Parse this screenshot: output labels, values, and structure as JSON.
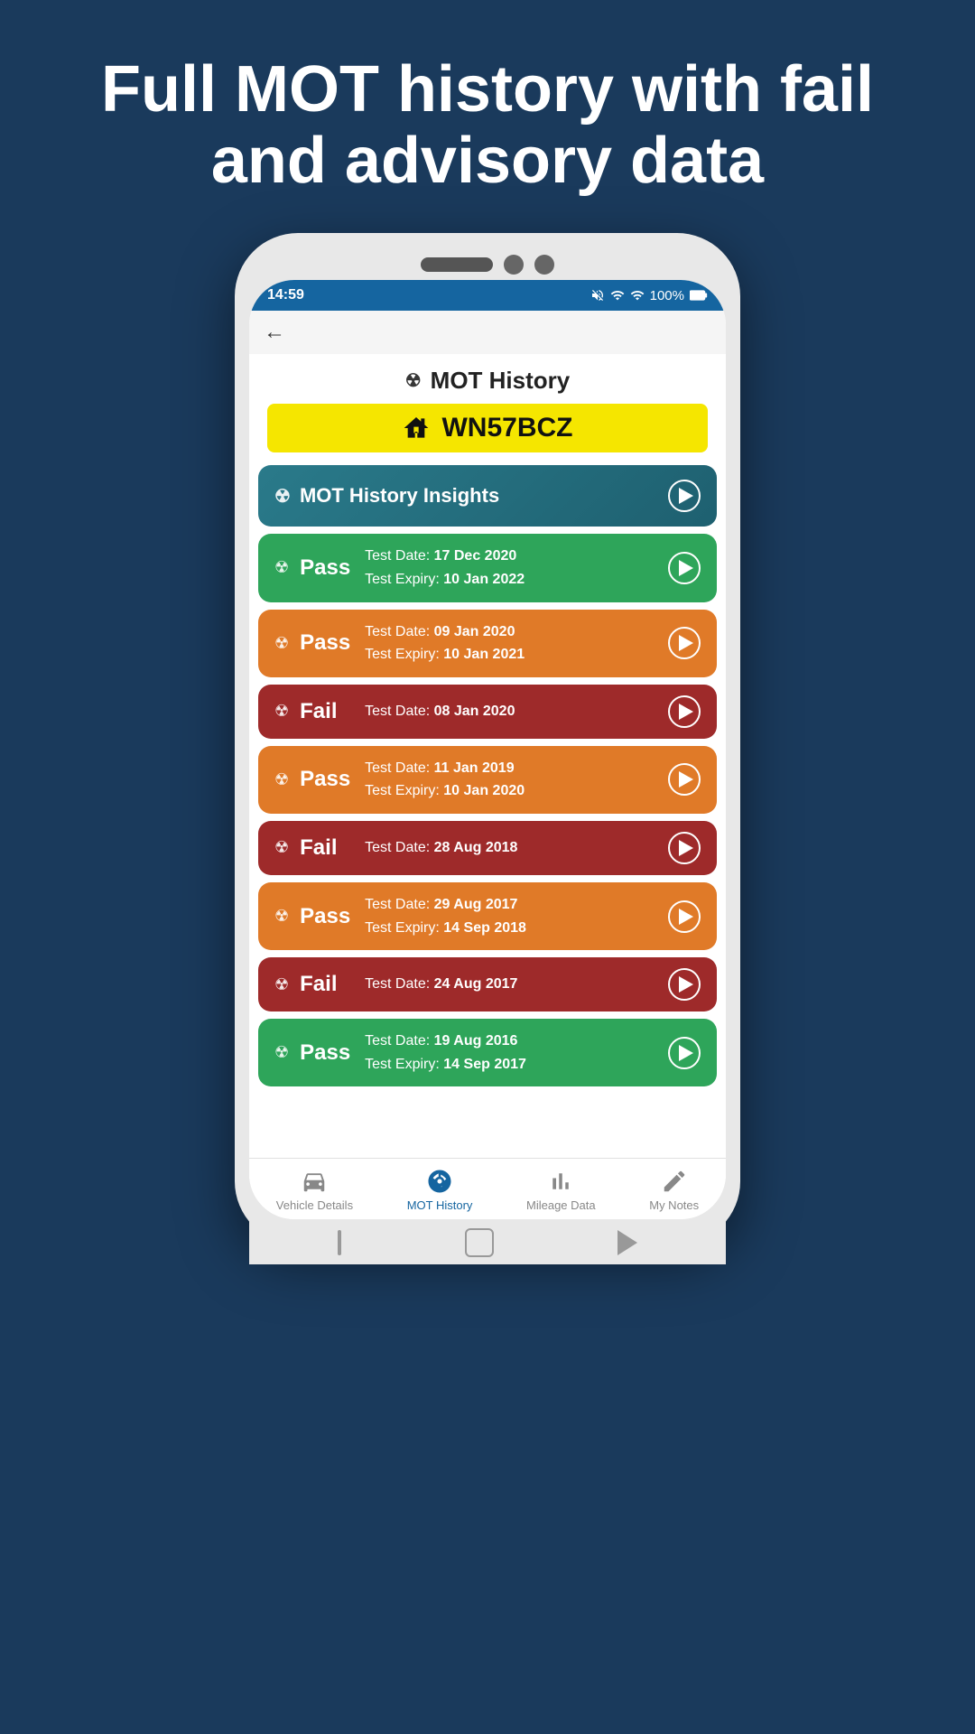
{
  "headline": "Full MOT history with fail and advisory data",
  "status_bar": {
    "time": "14:59",
    "battery": "100%",
    "signal_icons": "🔕 ☁ 📶 🔋"
  },
  "page_title": "MOT History",
  "plate": "WN57BCZ",
  "insights": {
    "label": "MOT History Insights"
  },
  "mot_entries": [
    {
      "status": "Pass",
      "type": "pass-green",
      "test_date": "17 Dec 2020",
      "expiry_date": "10 Jan 2022"
    },
    {
      "status": "Pass",
      "type": "pass-orange",
      "test_date": "09 Jan 2020",
      "expiry_date": "10 Jan 2021"
    },
    {
      "status": "Fail",
      "type": "fail-red",
      "test_date": "08 Jan 2020",
      "expiry_date": null
    },
    {
      "status": "Pass",
      "type": "pass-orange",
      "test_date": "11 Jan 2019",
      "expiry_date": "10 Jan 2020"
    },
    {
      "status": "Fail",
      "type": "fail-red",
      "test_date": "28 Aug 2018",
      "expiry_date": null
    },
    {
      "status": "Pass",
      "type": "pass-orange",
      "test_date": "29 Aug 2017",
      "expiry_date": "14 Sep 2018"
    },
    {
      "status": "Fail",
      "type": "fail-red",
      "test_date": "24 Aug 2017",
      "expiry_date": null
    },
    {
      "status": "Pass",
      "type": "pass-green",
      "test_date": "19 Aug 2016",
      "expiry_date": "14 Sep 2017"
    }
  ],
  "bottom_nav": {
    "items": [
      {
        "label": "Vehicle Details",
        "icon": "car",
        "active": false
      },
      {
        "label": "MOT History",
        "icon": "radiation",
        "active": true
      },
      {
        "label": "Mileage Data",
        "icon": "bar-chart",
        "active": false
      },
      {
        "label": "My Notes",
        "icon": "pencil",
        "active": false
      }
    ]
  },
  "labels": {
    "test_date_prefix": "Test Date:",
    "expiry_prefix": "Test Expiry:"
  }
}
